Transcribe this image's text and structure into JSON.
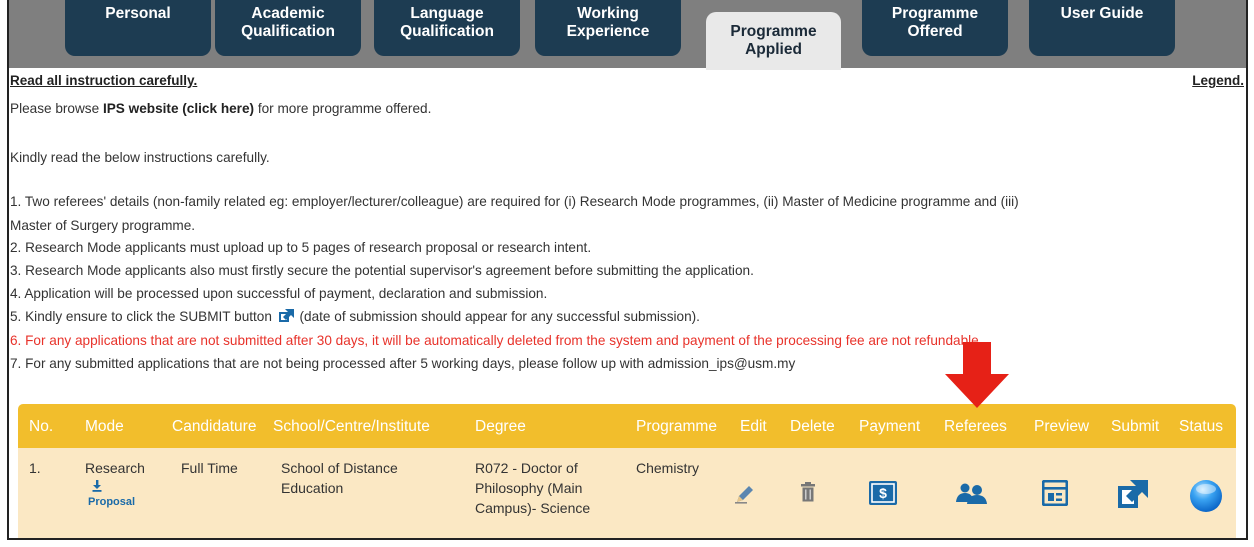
{
  "tabs": [
    {
      "label_line1": "Personal",
      "label_line2": ""
    },
    {
      "label_line1": "Academic",
      "label_line2": "Qualification"
    },
    {
      "label_line1": "Language",
      "label_line2": "Qualification"
    },
    {
      "label_line1": "Working",
      "label_line2": "Experience"
    },
    {
      "label_line1": "Programme",
      "label_line2": "Applied"
    },
    {
      "label_line1": "Programme",
      "label_line2": "Offered"
    },
    {
      "label_line1": "User Guide",
      "label_line2": ""
    }
  ],
  "links": {
    "read_instruction": "Read all instruction carefully.",
    "legend": "Legend."
  },
  "intro": {
    "browse_pre": "Please browse ",
    "browse_link": "IPS website (click here)",
    "browse_post": " for more programme offered.",
    "kindly": "Kindly read the below instructions carefully."
  },
  "instructions": {
    "i1a": "1. Two referees' details (non-family related eg: employer/lecturer/colleague) are required for (i) Research Mode programmes, (ii) Master of Medicine programme and (iii)",
    "i1b": "Master of Surgery programme.",
    "i2": "2. Research Mode applicants must upload up to 5 pages of research proposal or research intent.",
    "i3": "3. Research Mode applicants also must firstly secure the potential supervisor's agreement before submitting the application.",
    "i4": "4. Application will be processed upon successful of payment, declaration and submission.",
    "i5_pre": "5. Kindly ensure to click the SUBMIT button",
    "i5_post": "(date of submission should appear for any successful submission).",
    "i6": "6. For any applications that are not submitted after 30 days, it will be automatically deleted from the system and payment of the processing fee are not refundable.",
    "i7": "7. For any submitted applications that are not being processed after 5 working days, please follow up with admission_ips@usm.my"
  },
  "table": {
    "headers": [
      "No.",
      "Mode",
      "Candidature",
      "School/Centre/Institute",
      "Degree",
      "Programme",
      "Edit",
      "Delete",
      "Payment",
      "Referees",
      "Preview",
      "Submit",
      "Status"
    ],
    "row": {
      "no": "1.",
      "mode": "Research",
      "proposal": "Proposal",
      "candidature": "Full Time",
      "school_l1": "School of Distance",
      "school_l2": "Education",
      "degree_l1": "R072 - Doctor of",
      "degree_l2": "Philosophy (Main",
      "degree_l3": "Campus)- Science",
      "programme": "Chemistry",
      "payment_icon_text": "$"
    }
  },
  "icons": {
    "edit": "pencil-icon",
    "delete": "trash-icon",
    "payment": "payment-icon",
    "referees": "people-icon",
    "preview": "preview-icon",
    "submit": "external-link-icon",
    "status": "status-circle-icon",
    "annotation": "red-down-arrow"
  },
  "colors": {
    "tab_bg": "#1d3c52",
    "active_tab_bg": "#e9e9e9",
    "header_bg": "#f2be2c",
    "row_bg": "#fbe8c4",
    "icon_blue": "#1a6aa8",
    "warning_red": "#e8322a",
    "arrow_red": "#e62117"
  }
}
